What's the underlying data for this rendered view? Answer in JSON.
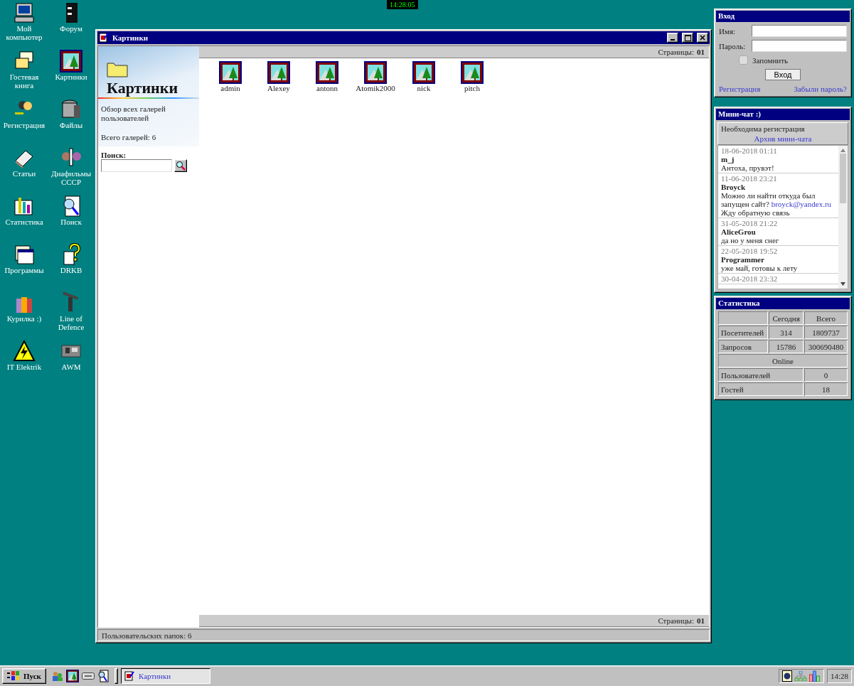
{
  "clock": "14:28:05",
  "desktop_icons": [
    {
      "label": "Мой компьютер"
    },
    {
      "label": "Форум"
    },
    {
      "label": "Гостевая книга"
    },
    {
      "label": "Картинки"
    },
    {
      "label": "Регистрация"
    },
    {
      "label": "Файлы"
    },
    {
      "label": "Статьи"
    },
    {
      "label": "Диафильмы СССР"
    },
    {
      "label": "Статистика"
    },
    {
      "label": "Поиск"
    },
    {
      "label": "Программы"
    },
    {
      "label": "DRKB"
    },
    {
      "label": "Курилка :)"
    },
    {
      "label": "Line of Defence"
    },
    {
      "label": "IT Elektrik"
    },
    {
      "label": "AWM"
    }
  ],
  "window": {
    "title": "Картинки",
    "sidebar": {
      "heading": "Картинки",
      "description": "Обзор всех галерей пользователей",
      "total": "Всего галерей: 6",
      "search_label": "Поиск:"
    },
    "pager_top": {
      "label": "Страницы:",
      "page": "01"
    },
    "galleries": [
      {
        "name": "admin"
      },
      {
        "name": "Alexey"
      },
      {
        "name": "antonn"
      },
      {
        "name": "Atomik2000"
      },
      {
        "name": "nick"
      },
      {
        "name": "pitch"
      }
    ],
    "pager_bottom": {
      "label": "Страницы:",
      "page": "01"
    },
    "status": "Пользовательских папок: 6"
  },
  "login": {
    "title": "Вход",
    "fields": [
      {
        "label": "Имя:"
      },
      {
        "label": "Пароль:"
      }
    ],
    "remember": {
      "label": "Запомнить",
      "checked": false
    },
    "button": "Вход",
    "links": [
      "Регистрация",
      "Забыли пароль?"
    ]
  },
  "chat": {
    "title": "Мини-чат :)",
    "notice": "Необходима регистрация",
    "archive_link": "Архив мини-чата",
    "messages": [
      {
        "date": "18-06-2018 01:11",
        "author": "m_j",
        "parts": [
          {
            "kind": "text",
            "text": "Антоха, прувэт!"
          }
        ]
      },
      {
        "date": "11-06-2018 23:21",
        "author": "Broyck",
        "parts": [
          {
            "kind": "text",
            "text": "Можно ли найти откуда был запущен сайт?"
          },
          {
            "kind": "link",
            "text": "broyck@yandex.ru"
          },
          {
            "kind": "text",
            "text": "Жду обратную связь"
          }
        ]
      },
      {
        "date": "31-05-2018 21:22",
        "author": "AliceGrou",
        "parts": [
          {
            "kind": "text",
            "text": "да но у меня снег"
          }
        ]
      },
      {
        "date": "22-05-2018 19:52",
        "author": "Programmer",
        "parts": [
          {
            "kind": "text",
            "text": "уже май, готовы к лету"
          }
        ]
      },
      {
        "date": "30-04-2018 23:32"
      }
    ]
  },
  "stats": {
    "title": "Статистика",
    "columns": [
      "Сегодня",
      "Всего"
    ],
    "rows": [
      {
        "label": "Посетителей",
        "today": "314",
        "total": "1809737"
      },
      {
        "label": "Запросов",
        "today": "15786",
        "total": "300690480"
      }
    ],
    "online_heading": "Online",
    "online_rows": [
      {
        "label": "Пользователей",
        "value": "0"
      },
      {
        "label": "Гостей",
        "value": "18"
      }
    ]
  },
  "taskbar": {
    "start": "Пуск",
    "tasks": [
      {
        "label": "Картинки",
        "active": true
      }
    ],
    "time": "14:28"
  }
}
